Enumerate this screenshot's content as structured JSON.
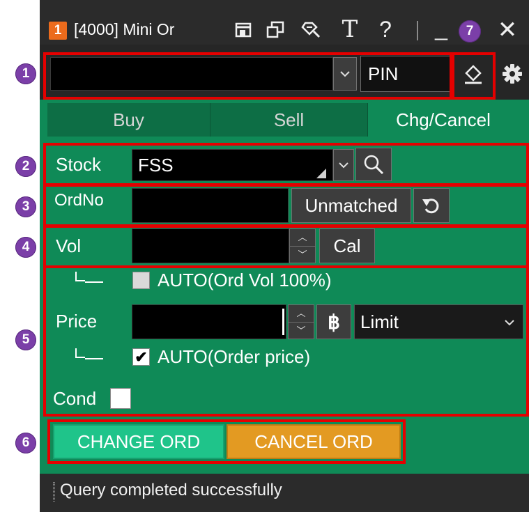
{
  "markers": [
    "1",
    "2",
    "3",
    "4",
    "5",
    "6",
    "7"
  ],
  "title": {
    "badge": "1",
    "text": "[4000] Mini Or",
    "icons": [
      "restore-window-icon",
      "copy-window-icon",
      "pin-tool-icon",
      "text-icon",
      "help-icon",
      "minimize-icon",
      "close-icon"
    ],
    "help_glyph": "?",
    "text_glyph": "T",
    "minimize_glyph": "_",
    "close_glyph": "✕"
  },
  "account": {
    "value": "",
    "dropdown_icon": "chevron-down-icon",
    "pin_label": "PIN",
    "eraser_icon": "eraser-icon",
    "settings_icon": "gear-icon"
  },
  "tabs": [
    {
      "label": "Buy",
      "active": false
    },
    {
      "label": "Sell",
      "active": false
    },
    {
      "label": "Chg/Cancel",
      "active": true
    }
  ],
  "stock": {
    "label": "Stock",
    "value": "FSS",
    "search_icon": "search-icon"
  },
  "order_no": {
    "label": "OrdNo",
    "value": "",
    "unmatched_label": "Unmatched",
    "refresh_icon": "refresh-icon"
  },
  "volume": {
    "label": "Vol",
    "value": "",
    "cal_label": "Cal"
  },
  "auto_vol": {
    "label": "AUTO(Ord Vol 100%)",
    "checked": false,
    "enabled": false
  },
  "price": {
    "label": "Price",
    "value": "",
    "currency_icon": "baht-icon",
    "currency_glyph": "฿",
    "type_value": "Limit"
  },
  "auto_price": {
    "label": "AUTO(Order price)",
    "checked": true
  },
  "cond": {
    "label": "Cond",
    "checked": false
  },
  "actions": {
    "change_label": "CHANGE ORD",
    "cancel_label": "CANCEL ORD"
  },
  "status": {
    "message": "Query completed successfully"
  },
  "colors": {
    "panel_green": "#0f8a57",
    "change_button": "#1fc48a",
    "cancel_button": "#e39a22",
    "highlight_red": "#e50000",
    "marker_purple": "#7b3fa8"
  }
}
